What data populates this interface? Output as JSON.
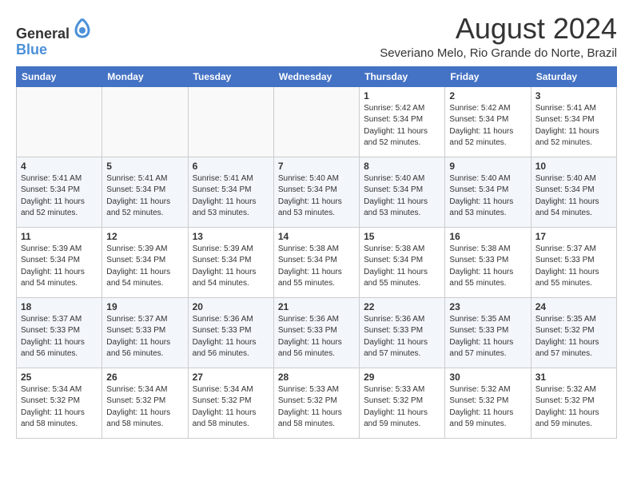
{
  "header": {
    "logo_line1": "General",
    "logo_line2": "Blue",
    "month_title": "August 2024",
    "subtitle": "Severiano Melo, Rio Grande do Norte, Brazil"
  },
  "weekdays": [
    "Sunday",
    "Monday",
    "Tuesday",
    "Wednesday",
    "Thursday",
    "Friday",
    "Saturday"
  ],
  "weeks": [
    [
      {
        "day": "",
        "info": ""
      },
      {
        "day": "",
        "info": ""
      },
      {
        "day": "",
        "info": ""
      },
      {
        "day": "",
        "info": ""
      },
      {
        "day": "1",
        "info": "Sunrise: 5:42 AM\nSunset: 5:34 PM\nDaylight: 11 hours\nand 52 minutes."
      },
      {
        "day": "2",
        "info": "Sunrise: 5:42 AM\nSunset: 5:34 PM\nDaylight: 11 hours\nand 52 minutes."
      },
      {
        "day": "3",
        "info": "Sunrise: 5:41 AM\nSunset: 5:34 PM\nDaylight: 11 hours\nand 52 minutes."
      }
    ],
    [
      {
        "day": "4",
        "info": "Sunrise: 5:41 AM\nSunset: 5:34 PM\nDaylight: 11 hours\nand 52 minutes."
      },
      {
        "day": "5",
        "info": "Sunrise: 5:41 AM\nSunset: 5:34 PM\nDaylight: 11 hours\nand 52 minutes."
      },
      {
        "day": "6",
        "info": "Sunrise: 5:41 AM\nSunset: 5:34 PM\nDaylight: 11 hours\nand 53 minutes."
      },
      {
        "day": "7",
        "info": "Sunrise: 5:40 AM\nSunset: 5:34 PM\nDaylight: 11 hours\nand 53 minutes."
      },
      {
        "day": "8",
        "info": "Sunrise: 5:40 AM\nSunset: 5:34 PM\nDaylight: 11 hours\nand 53 minutes."
      },
      {
        "day": "9",
        "info": "Sunrise: 5:40 AM\nSunset: 5:34 PM\nDaylight: 11 hours\nand 53 minutes."
      },
      {
        "day": "10",
        "info": "Sunrise: 5:40 AM\nSunset: 5:34 PM\nDaylight: 11 hours\nand 54 minutes."
      }
    ],
    [
      {
        "day": "11",
        "info": "Sunrise: 5:39 AM\nSunset: 5:34 PM\nDaylight: 11 hours\nand 54 minutes."
      },
      {
        "day": "12",
        "info": "Sunrise: 5:39 AM\nSunset: 5:34 PM\nDaylight: 11 hours\nand 54 minutes."
      },
      {
        "day": "13",
        "info": "Sunrise: 5:39 AM\nSunset: 5:34 PM\nDaylight: 11 hours\nand 54 minutes."
      },
      {
        "day": "14",
        "info": "Sunrise: 5:38 AM\nSunset: 5:34 PM\nDaylight: 11 hours\nand 55 minutes."
      },
      {
        "day": "15",
        "info": "Sunrise: 5:38 AM\nSunset: 5:34 PM\nDaylight: 11 hours\nand 55 minutes."
      },
      {
        "day": "16",
        "info": "Sunrise: 5:38 AM\nSunset: 5:33 PM\nDaylight: 11 hours\nand 55 minutes."
      },
      {
        "day": "17",
        "info": "Sunrise: 5:37 AM\nSunset: 5:33 PM\nDaylight: 11 hours\nand 55 minutes."
      }
    ],
    [
      {
        "day": "18",
        "info": "Sunrise: 5:37 AM\nSunset: 5:33 PM\nDaylight: 11 hours\nand 56 minutes."
      },
      {
        "day": "19",
        "info": "Sunrise: 5:37 AM\nSunset: 5:33 PM\nDaylight: 11 hours\nand 56 minutes."
      },
      {
        "day": "20",
        "info": "Sunrise: 5:36 AM\nSunset: 5:33 PM\nDaylight: 11 hours\nand 56 minutes."
      },
      {
        "day": "21",
        "info": "Sunrise: 5:36 AM\nSunset: 5:33 PM\nDaylight: 11 hours\nand 56 minutes."
      },
      {
        "day": "22",
        "info": "Sunrise: 5:36 AM\nSunset: 5:33 PM\nDaylight: 11 hours\nand 57 minutes."
      },
      {
        "day": "23",
        "info": "Sunrise: 5:35 AM\nSunset: 5:33 PM\nDaylight: 11 hours\nand 57 minutes."
      },
      {
        "day": "24",
        "info": "Sunrise: 5:35 AM\nSunset: 5:32 PM\nDaylight: 11 hours\nand 57 minutes."
      }
    ],
    [
      {
        "day": "25",
        "info": "Sunrise: 5:34 AM\nSunset: 5:32 PM\nDaylight: 11 hours\nand 58 minutes."
      },
      {
        "day": "26",
        "info": "Sunrise: 5:34 AM\nSunset: 5:32 PM\nDaylight: 11 hours\nand 58 minutes."
      },
      {
        "day": "27",
        "info": "Sunrise: 5:34 AM\nSunset: 5:32 PM\nDaylight: 11 hours\nand 58 minutes."
      },
      {
        "day": "28",
        "info": "Sunrise: 5:33 AM\nSunset: 5:32 PM\nDaylight: 11 hours\nand 58 minutes."
      },
      {
        "day": "29",
        "info": "Sunrise: 5:33 AM\nSunset: 5:32 PM\nDaylight: 11 hours\nand 59 minutes."
      },
      {
        "day": "30",
        "info": "Sunrise: 5:32 AM\nSunset: 5:32 PM\nDaylight: 11 hours\nand 59 minutes."
      },
      {
        "day": "31",
        "info": "Sunrise: 5:32 AM\nSunset: 5:32 PM\nDaylight: 11 hours\nand 59 minutes."
      }
    ]
  ]
}
